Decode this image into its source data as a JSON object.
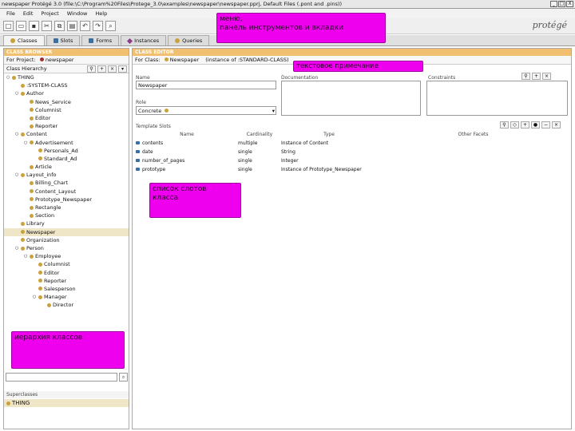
{
  "window": {
    "title": "newspaper  Protégé 3.0    (file:\\C:\\Program%20Files\\Protege_3.0\\examples\\newspaper\\newspaper.pprj, Default Files (.pont and .pins))",
    "controls": [
      "_",
      "□",
      "X"
    ]
  },
  "menu": [
    "File",
    "Edit",
    "Project",
    "Window",
    "Help"
  ],
  "toolbar_icons": [
    "new-icon",
    "open-icon",
    "save-icon",
    "cut-icon",
    "copy-icon",
    "paste-icon",
    "undo-icon",
    "redo-icon",
    "find-icon"
  ],
  "logo": "protégé",
  "tabs": [
    {
      "label": "Classes",
      "icon": "class-icon",
      "active": true
    },
    {
      "label": "Slots",
      "icon": "slot-icon",
      "active": false
    },
    {
      "label": "Forms",
      "icon": "form-icon",
      "active": false
    },
    {
      "label": "Instances",
      "icon": "instance-icon",
      "active": false
    },
    {
      "label": "Queries",
      "icon": "query-icon",
      "active": false
    }
  ],
  "left": {
    "header": "CLASS BROWSER",
    "project_label": "For Project:",
    "project_name": "newspaper",
    "hierarchy_label": "Class Hierarchy",
    "tree": [
      {
        "label": "THING",
        "depth": 0
      },
      {
        "label": ":SYSTEM-CLASS",
        "depth": 1
      },
      {
        "label": "Author",
        "depth": 1
      },
      {
        "label": "News_Service",
        "depth": 2
      },
      {
        "label": "Columnist",
        "depth": 2
      },
      {
        "label": "Editor",
        "depth": 2
      },
      {
        "label": "Reporter",
        "depth": 2
      },
      {
        "label": "Content",
        "depth": 1
      },
      {
        "label": "Advertisement",
        "depth": 2
      },
      {
        "label": "Personals_Ad",
        "depth": 3
      },
      {
        "label": "Standard_Ad",
        "depth": 3
      },
      {
        "label": "Article",
        "depth": 2
      },
      {
        "label": "Layout_info",
        "depth": 1
      },
      {
        "label": "Billing_Chart",
        "depth": 2
      },
      {
        "label": "Content_Layout",
        "depth": 2
      },
      {
        "label": "Prototype_Newspaper",
        "depth": 2
      },
      {
        "label": "Rectangle",
        "depth": 2
      },
      {
        "label": "Section",
        "depth": 2
      },
      {
        "label": "Library",
        "depth": 1
      },
      {
        "label": "Newspaper",
        "depth": 1,
        "selected": true
      },
      {
        "label": "Organization",
        "depth": 1
      },
      {
        "label": "Person",
        "depth": 1
      },
      {
        "label": "Employee",
        "depth": 2
      },
      {
        "label": "Columnist",
        "depth": 3
      },
      {
        "label": "Editor",
        "depth": 3
      },
      {
        "label": "Reporter",
        "depth": 3
      },
      {
        "label": "Salesperson",
        "depth": 3
      },
      {
        "label": "Manager",
        "depth": 3
      },
      {
        "label": "Director",
        "depth": 4
      }
    ],
    "superclasses_label": "Superclasses",
    "superclass": "THING"
  },
  "main": {
    "header": "CLASS EDITOR",
    "for_class_label": "For Class:",
    "class_name": "Newspaper",
    "instance_of": "(instance of :STANDARD-CLASS)",
    "name_label": "Name",
    "name_value": "Newspaper",
    "documentation_label": "Documentation",
    "constraints_label": "Constraints",
    "role_label": "Role",
    "role_value": "Concrete",
    "template_slots_label": "Template Slots",
    "columns": [
      "Name",
      "Cardinality",
      "Type",
      "Other Facets"
    ],
    "slots": [
      {
        "name": "contents",
        "cardinality": "multiple",
        "type": "Instance of Content",
        "facets": ""
      },
      {
        "name": "date",
        "cardinality": "single",
        "type": "String",
        "facets": ""
      },
      {
        "name": "number_of_pages",
        "cardinality": "single",
        "type": "Integer",
        "facets": ""
      },
      {
        "name": "prototype",
        "cardinality": "single",
        "type": "Instance of Prototype_Newspaper",
        "facets": ""
      }
    ]
  },
  "annotations": {
    "menu_note": "меню,\nпанель инструментов и вкладки",
    "text_note": "текстовое примечание",
    "slots_note": "список слотов\nкласса",
    "hierarchy_note": "иерархия классов"
  },
  "colors": {
    "header": "#f0c070",
    "annotation": "#ee00ee",
    "selection": "#efe6c8"
  }
}
